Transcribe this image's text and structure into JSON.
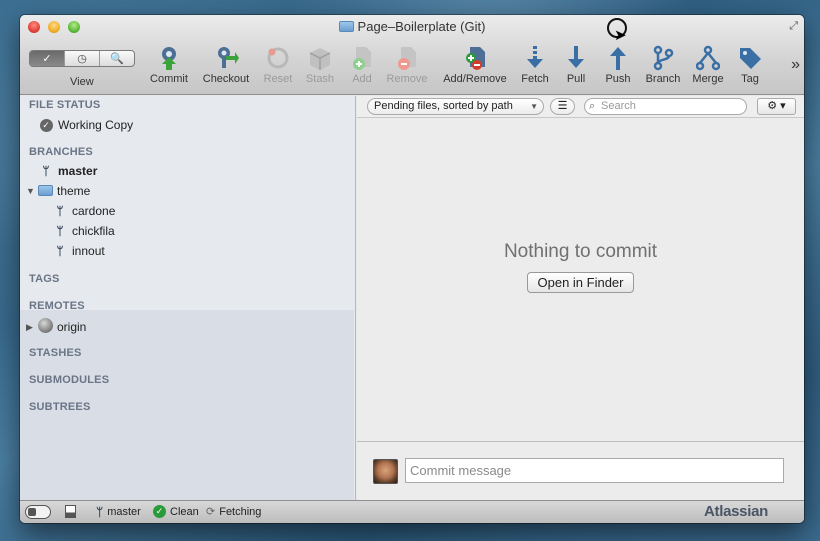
{
  "window": {
    "title": "Page–Boilerplate (Git)"
  },
  "toolbar": {
    "view_label": "View",
    "view_segments": [
      "✓",
      "◷",
      "🔍"
    ],
    "tools": [
      {
        "label": "Commit",
        "icon": "commit-icon",
        "disabled": false
      },
      {
        "label": "Checkout",
        "icon": "checkout-icon",
        "disabled": false
      },
      {
        "label": "Reset",
        "icon": "reset-icon",
        "disabled": true
      },
      {
        "label": "Stash",
        "icon": "stash-icon",
        "disabled": true
      },
      {
        "label": "Add",
        "icon": "add-icon",
        "disabled": true
      },
      {
        "label": "Remove",
        "icon": "remove-icon",
        "disabled": true
      },
      {
        "label": "Add/Remove",
        "icon": "add-remove-icon",
        "disabled": false
      },
      {
        "label": "Fetch",
        "icon": "fetch-icon",
        "disabled": false
      },
      {
        "label": "Pull",
        "icon": "pull-icon",
        "disabled": false
      },
      {
        "label": "Push",
        "icon": "push-icon",
        "disabled": false
      },
      {
        "label": "Branch",
        "icon": "branch-icon",
        "disabled": false
      },
      {
        "label": "Merge",
        "icon": "merge-icon",
        "disabled": false
      },
      {
        "label": "Tag",
        "icon": "tag-icon",
        "disabled": false
      }
    ],
    "overflow": "»"
  },
  "sidebar": {
    "file_status": {
      "header": "FILE STATUS",
      "items": [
        {
          "label": "Working Copy"
        }
      ]
    },
    "branches": {
      "header": "BRANCHES",
      "current": "master",
      "folder": "theme",
      "folder_items": [
        "cardone",
        "chickfila",
        "innout"
      ]
    },
    "tags": {
      "header": "TAGS"
    },
    "remotes": {
      "header": "REMOTES",
      "items": [
        "origin"
      ]
    },
    "stashes": {
      "header": "STASHES"
    },
    "submodules": {
      "header": "SUBMODULES"
    },
    "subtrees": {
      "header": "SUBTREES"
    }
  },
  "main": {
    "filter_label": "Pending files, sorted by path",
    "search_placeholder": "Search",
    "empty_message": "Nothing to commit",
    "open_finder_label": "Open in Finder",
    "commit_placeholder": "Commit message"
  },
  "statusbar": {
    "branch": "master",
    "clean": "Clean",
    "fetching": "Fetching",
    "brand": "Atlassian"
  },
  "colors": {
    "accent_green": "#2a9a3a",
    "icon_blue": "#3a6fa5",
    "sidebar_bg": "#e6e9ee"
  }
}
